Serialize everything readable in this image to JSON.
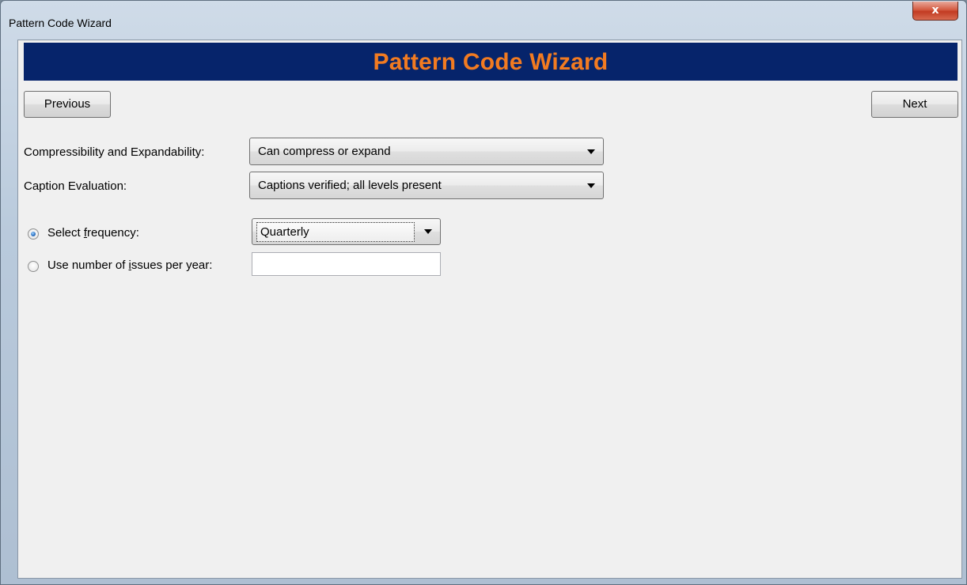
{
  "window": {
    "title": "Pattern Code Wizard",
    "close_glyph": "x"
  },
  "banner": {
    "title": "Pattern Code Wizard"
  },
  "nav": {
    "previous_label": "Previous",
    "next_label": "Next"
  },
  "fields": {
    "compress": {
      "label": "Compressibility and Expandability:",
      "value": "Can compress or expand"
    },
    "caption": {
      "label": "Caption Evaluation:",
      "value": "Captions verified; all levels present"
    },
    "frequency": {
      "label_before": "Select ",
      "label_mnemonic": "f",
      "label_after": "requency:",
      "value": "Quarterly",
      "selected": true
    },
    "issues": {
      "label_before": "Use number of ",
      "label_mnemonic": "i",
      "label_after": "ssues per year:",
      "value": "",
      "selected": false
    }
  },
  "colors": {
    "banner_bg": "#06246b",
    "banner_text": "#f27b21",
    "client_bg": "#f0f0f0"
  },
  "icons": {
    "close": "close-icon",
    "dropdown": "chevron-down-icon",
    "radio_checked": "radio-checked-icon",
    "radio_unchecked": "radio-unchecked-icon"
  }
}
